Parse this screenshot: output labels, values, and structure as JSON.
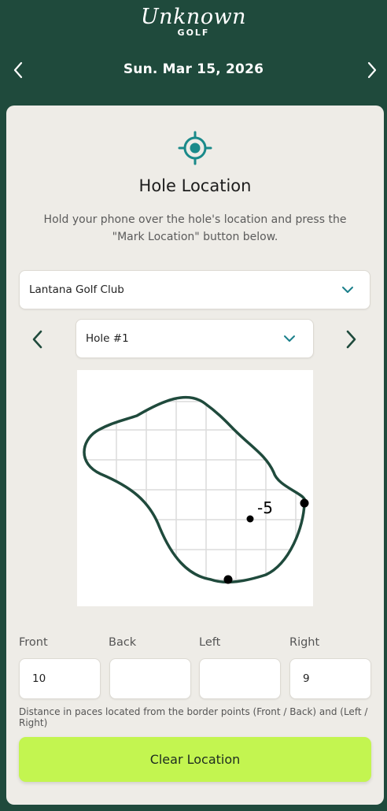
{
  "brand": {
    "script": "Unknown",
    "sub": "GOLF"
  },
  "date_bar": {
    "date": "Sun. Mar 15, 2026",
    "prev_icon": "chevron-left-icon",
    "next_icon": "chevron-right-icon"
  },
  "card": {
    "icon": "crosshair-icon",
    "title": "Hole Location",
    "description": "Hold your phone over the hole's location and press the \"Mark Location\" button below."
  },
  "course_select": {
    "value": "Lantana Golf Club"
  },
  "hole_select": {
    "value": "Hole #1"
  },
  "green_map": {
    "pin_label": "-5"
  },
  "distances": {
    "front": {
      "label": "Front",
      "value": "10"
    },
    "back": {
      "label": "Back",
      "value": ""
    },
    "left": {
      "label": "Left",
      "value": ""
    },
    "right": {
      "label": "Right",
      "value": "9"
    }
  },
  "help_text": "Distance in paces located from the border points (Front / Back) and (Left / Right)",
  "clear_button": {
    "label": "Clear Location"
  },
  "colors": {
    "background": "#1f4a3c",
    "card": "#eeece7",
    "accent": "#1a8a8a",
    "button": "#c3f550",
    "green_outline": "#1f4a3c"
  }
}
